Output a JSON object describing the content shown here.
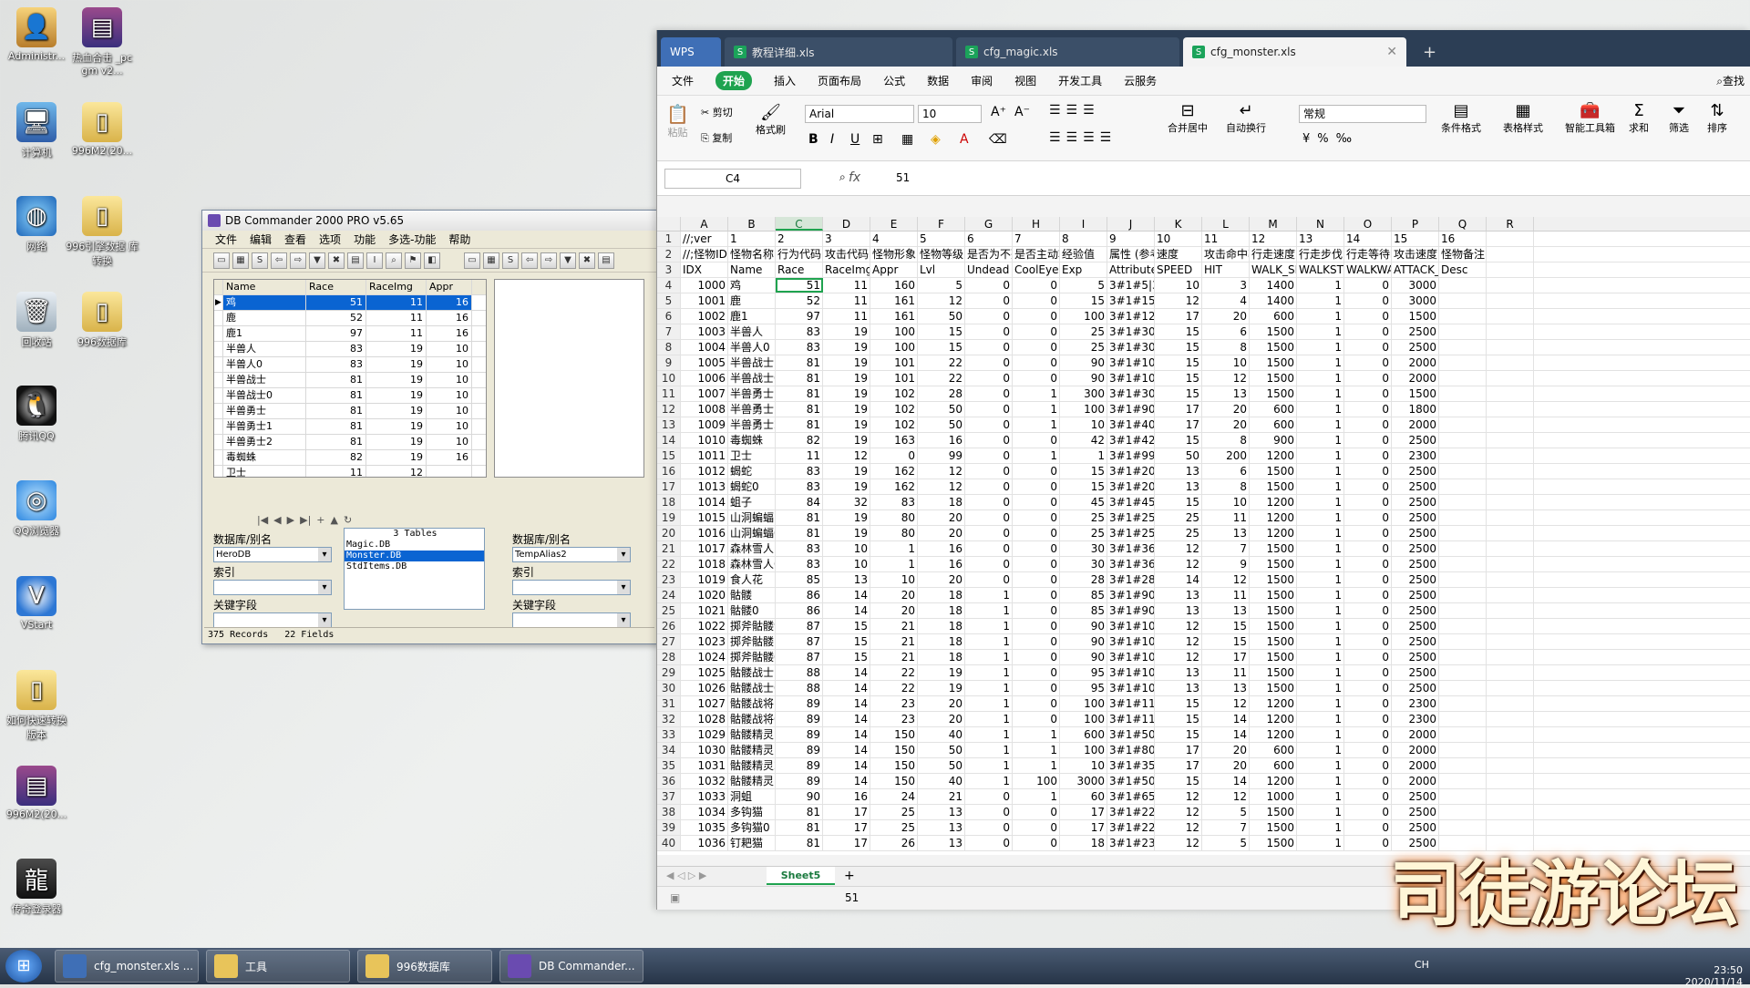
{
  "desktop": {
    "icons": [
      {
        "label": "Administr...",
        "icon": "user-folder-icon"
      },
      {
        "label": "热血合击\n_pc gm v2...",
        "icon": "rar-archive-icon"
      },
      {
        "label": "计算机",
        "icon": "computer-icon"
      },
      {
        "label": "996M2(20...",
        "icon": "folder-icon"
      },
      {
        "label": "网络",
        "icon": "network-icon"
      },
      {
        "label": "996引擎数据\n库转换",
        "icon": "folder-icon"
      },
      {
        "label": "回收站",
        "icon": "recycle-bin-icon"
      },
      {
        "label": "996数据库",
        "icon": "folder-icon"
      },
      {
        "label": "腾讯QQ",
        "icon": "qq-icon"
      },
      {
        "label": "QQ浏览器",
        "icon": "browser-icon"
      },
      {
        "label": "VStart",
        "icon": "vstart-icon"
      },
      {
        "label": "如何快速转换\n版本",
        "icon": "folder-icon"
      },
      {
        "label": "996M2(20...",
        "icon": "rar-archive-icon"
      },
      {
        "label": "传奇登录器",
        "icon": "game-launcher-icon"
      }
    ]
  },
  "dbc": {
    "title": "DB Commander 2000 PRO v5.65",
    "menu": [
      "文件",
      "编辑",
      "查看",
      "选项",
      "功能",
      "多选-功能",
      "帮助"
    ],
    "columns": [
      "Name",
      "Race",
      "RaceImg",
      "Appr"
    ],
    "rows": [
      [
        "鸡",
        "51",
        "11",
        "16"
      ],
      [
        "鹿",
        "52",
        "11",
        "16"
      ],
      [
        "鹿1",
        "97",
        "11",
        "16"
      ],
      [
        "半兽人",
        "83",
        "19",
        "10"
      ],
      [
        "半兽人0",
        "83",
        "19",
        "10"
      ],
      [
        "半兽战士",
        "81",
        "19",
        "10"
      ],
      [
        "半兽战士0",
        "81",
        "19",
        "10"
      ],
      [
        "半兽勇士",
        "81",
        "19",
        "10"
      ],
      [
        "半兽勇士1",
        "81",
        "19",
        "10"
      ],
      [
        "半兽勇士2",
        "81",
        "19",
        "10"
      ],
      [
        "毒蜘蛛",
        "82",
        "19",
        "16"
      ],
      [
        "卫士",
        "11",
        "12",
        ""
      ]
    ],
    "left_panel": {
      "db_label": "数据库/别名",
      "db_value": "HeroDB",
      "index_label": "索引",
      "key_label": "关键字段"
    },
    "tables_header": "3 Tables",
    "tables": [
      "Magic.DB",
      "Monster.DB",
      "StdItems.DB"
    ],
    "right_panel": {
      "db_label": "数据库/别名",
      "db_value": "TempAlias2",
      "index_label": "索引",
      "key_label": "关键字段"
    },
    "status": [
      "375 Records",
      "22 Fields"
    ]
  },
  "wps": {
    "tabs": [
      {
        "label": "WPS"
      },
      {
        "label": "教程详细.xls"
      },
      {
        "label": "cfg_magic.xls"
      },
      {
        "label": "cfg_monster.xls"
      }
    ],
    "menu": [
      "文件",
      "开始",
      "插入",
      "页面布局",
      "公式",
      "数据",
      "审阅",
      "视图",
      "开发工具",
      "云服务"
    ],
    "search_label": "查找",
    "ribbon": {
      "paste": "粘贴",
      "cut": "剪切",
      "copy": "复制",
      "format_painter": "格式刷",
      "font": "Arial",
      "font_size": "10",
      "number_format": "常规",
      "merge": "合并居中",
      "wrap": "自动换行",
      "cond_format": "条件格式",
      "table_style": "表格样式",
      "smart_tools": "智能工具箱",
      "sum": "求和",
      "filter": "筛选",
      "sort": "排序"
    },
    "cell_ref": "C4",
    "formula_value": "51",
    "columns": [
      "A",
      "B",
      "C",
      "D",
      "E",
      "F",
      "G",
      "H",
      "I",
      "J",
      "K",
      "L",
      "M",
      "N",
      "O",
      "P",
      "Q",
      "R"
    ],
    "header_rows": [
      [
        "//;ver",
        "1",
        "2",
        "3",
        "4",
        "5",
        "6",
        "7",
        "8",
        "9",
        "10",
        "11",
        "12",
        "13",
        "14",
        "15",
        "16",
        ""
      ],
      [
        "//;怪物IDX",
        "怪物名称",
        "行为代码",
        "攻击代码",
        "怪物形象",
        "怪物等级",
        "是否为不死",
        "是否主动攻击",
        "经验值",
        "属性 (参考",
        "速度",
        "攻击命中率",
        "行走速度间隔",
        "行走步伐",
        "行走等待时间",
        "攻击速度间隔",
        "怪物备注",
        ""
      ],
      [
        "IDX",
        "Name",
        "Race",
        "RaceImg",
        "Appr",
        "Lvl",
        "Undead",
        "CoolEye",
        "Exp",
        "Attribute",
        "SPEED",
        "HIT",
        "WALK_SPEED",
        "WALKSTEP",
        "WALKWAIT",
        "ATTACK_SPEED",
        "Desc",
        ""
      ]
    ],
    "rows": [
      [
        "1000",
        "鸡",
        "51",
        "11",
        "160",
        "5",
        "0",
        "0",
        "5",
        "3#1#5|3#",
        "10",
        "3",
        "1400",
        "1",
        "0",
        "3000"
      ],
      [
        "1001",
        "鹿",
        "52",
        "11",
        "161",
        "12",
        "0",
        "0",
        "15",
        "3#1#15|3#",
        "12",
        "4",
        "1400",
        "1",
        "0",
        "3000"
      ],
      [
        "1002",
        "鹿1",
        "97",
        "11",
        "161",
        "50",
        "0",
        "0",
        "100",
        "3#1#1200|",
        "17",
        "20",
        "600",
        "1",
        "0",
        "1500"
      ],
      [
        "1003",
        "半兽人",
        "83",
        "19",
        "100",
        "15",
        "0",
        "0",
        "25",
        "3#1#30|3#",
        "15",
        "6",
        "1500",
        "1",
        "0",
        "2500"
      ],
      [
        "1004",
        "半兽人0",
        "83",
        "19",
        "100",
        "15",
        "0",
        "0",
        "25",
        "3#1#30|3#",
        "15",
        "8",
        "1500",
        "1",
        "0",
        "2500"
      ],
      [
        "1005",
        "半兽战士",
        "81",
        "19",
        "101",
        "22",
        "0",
        "0",
        "90",
        "3#1#100|3",
        "15",
        "10",
        "1500",
        "1",
        "0",
        "2000"
      ],
      [
        "1006",
        "半兽战士0",
        "81",
        "19",
        "101",
        "22",
        "0",
        "0",
        "90",
        "3#1#100|3",
        "15",
        "12",
        "1500",
        "1",
        "0",
        "2000"
      ],
      [
        "1007",
        "半兽勇士",
        "81",
        "19",
        "102",
        "28",
        "0",
        "1",
        "300",
        "3#1#300|3",
        "15",
        "13",
        "1500",
        "1",
        "0",
        "1500"
      ],
      [
        "1008",
        "半兽勇士1",
        "81",
        "19",
        "102",
        "50",
        "0",
        "1",
        "100",
        "3#1#900|3",
        "17",
        "20",
        "600",
        "1",
        "0",
        "1800"
      ],
      [
        "1009",
        "半兽勇士2",
        "81",
        "19",
        "102",
        "50",
        "0",
        "1",
        "10",
        "3#1#400|3",
        "17",
        "20",
        "600",
        "1",
        "0",
        "2000"
      ],
      [
        "1010",
        "毒蜘蛛",
        "82",
        "19",
        "163",
        "16",
        "0",
        "0",
        "42",
        "3#1#42|3#",
        "15",
        "8",
        "900",
        "1",
        "0",
        "2500"
      ],
      [
        "1011",
        "卫士",
        "11",
        "12",
        "0",
        "99",
        "0",
        "1",
        "1",
        "3#1#9999|",
        "50",
        "200",
        "1200",
        "1",
        "0",
        "2300"
      ],
      [
        "1012",
        "蝎蛇",
        "83",
        "19",
        "162",
        "12",
        "0",
        "0",
        "15",
        "3#1#20|3#",
        "13",
        "6",
        "1500",
        "1",
        "0",
        "2500"
      ],
      [
        "1013",
        "蝎蛇0",
        "83",
        "19",
        "162",
        "12",
        "0",
        "0",
        "15",
        "3#1#20|3#",
        "13",
        "8",
        "1500",
        "1",
        "0",
        "2500"
      ],
      [
        "1014",
        "蛆子",
        "84",
        "32",
        "83",
        "18",
        "0",
        "0",
        "45",
        "3#1#45|3#",
        "15",
        "10",
        "1200",
        "1",
        "0",
        "2500"
      ],
      [
        "1015",
        "山洞蝙蝠",
        "81",
        "19",
        "80",
        "20",
        "0",
        "0",
        "25",
        "3#1#25|3#",
        "25",
        "11",
        "1200",
        "1",
        "0",
        "2500"
      ],
      [
        "1016",
        "山洞蝙蝠0",
        "81",
        "19",
        "80",
        "20",
        "0",
        "0",
        "25",
        "3#1#25|3#",
        "25",
        "13",
        "1200",
        "1",
        "0",
        "2500"
      ],
      [
        "1017",
        "森林雪人",
        "83",
        "10",
        "1",
        "16",
        "0",
        "0",
        "30",
        "3#1#36|3#",
        "12",
        "7",
        "1500",
        "1",
        "0",
        "2500"
      ],
      [
        "1018",
        "森林雪人0",
        "83",
        "10",
        "1",
        "16",
        "0",
        "0",
        "30",
        "3#1#36|3#",
        "12",
        "9",
        "1500",
        "1",
        "0",
        "2500"
      ],
      [
        "1019",
        "食人花",
        "85",
        "13",
        "10",
        "20",
        "0",
        "0",
        "28",
        "3#1#28|3#",
        "14",
        "12",
        "1500",
        "1",
        "0",
        "2500"
      ],
      [
        "1020",
        "骷髅",
        "86",
        "14",
        "20",
        "18",
        "1",
        "0",
        "85",
        "3#1#90|3#",
        "13",
        "11",
        "1500",
        "1",
        "0",
        "2500"
      ],
      [
        "1021",
        "骷髅0",
        "86",
        "14",
        "20",
        "18",
        "1",
        "0",
        "85",
        "3#1#90|3#",
        "13",
        "13",
        "1500",
        "1",
        "0",
        "2500"
      ],
      [
        "1022",
        "掷斧骷髅9",
        "87",
        "15",
        "21",
        "18",
        "1",
        "0",
        "90",
        "3#1#100|3",
        "12",
        "15",
        "1500",
        "1",
        "0",
        "2500"
      ],
      [
        "1023",
        "掷斧骷髅",
        "87",
        "15",
        "21",
        "18",
        "1",
        "0",
        "90",
        "3#1#100|3",
        "12",
        "15",
        "1500",
        "1",
        "0",
        "2500"
      ],
      [
        "1024",
        "掷斧骷髅0",
        "87",
        "15",
        "21",
        "18",
        "1",
        "0",
        "90",
        "3#1#100|3",
        "12",
        "17",
        "1500",
        "1",
        "0",
        "2500"
      ],
      [
        "1025",
        "骷髅战士",
        "88",
        "14",
        "22",
        "19",
        "1",
        "0",
        "95",
        "3#1#105|3",
        "13",
        "11",
        "1500",
        "1",
        "0",
        "2500"
      ],
      [
        "1026",
        "骷髅战士0",
        "88",
        "14",
        "22",
        "19",
        "1",
        "0",
        "95",
        "3#1#105|3",
        "13",
        "13",
        "1500",
        "1",
        "0",
        "2500"
      ],
      [
        "1027",
        "骷髅战将",
        "89",
        "14",
        "23",
        "20",
        "1",
        "0",
        "100",
        "3#1#110|3",
        "15",
        "12",
        "1200",
        "1",
        "0",
        "2300"
      ],
      [
        "1028",
        "骷髅战将0",
        "89",
        "14",
        "23",
        "20",
        "1",
        "0",
        "100",
        "3#1#110|3",
        "15",
        "14",
        "1200",
        "1",
        "0",
        "2300"
      ],
      [
        "1029",
        "骷髅精灵",
        "89",
        "14",
        "150",
        "40",
        "1",
        "1",
        "600",
        "3#1#500|3",
        "15",
        "14",
        "1200",
        "1",
        "0",
        "2000"
      ],
      [
        "1030",
        "骷髅精灵1",
        "89",
        "14",
        "150",
        "50",
        "1",
        "1",
        "100",
        "3#1#800|3",
        "17",
        "20",
        "600",
        "1",
        "0",
        "2000"
      ],
      [
        "1031",
        "骷髅精灵2",
        "89",
        "14",
        "150",
        "50",
        "1",
        "1",
        "10",
        "3#1#350|3",
        "17",
        "20",
        "600",
        "1",
        "0",
        "2000"
      ],
      [
        "1032",
        "骷髅精灵10",
        "89",
        "14",
        "150",
        "40",
        "1",
        "100",
        "3000",
        "3#1#500|3",
        "15",
        "14",
        "1200",
        "1",
        "0",
        "2000"
      ],
      [
        "1033",
        "洞蛆",
        "90",
        "16",
        "24",
        "21",
        "0",
        "1",
        "60",
        "3#1#65|3#",
        "12",
        "12",
        "1000",
        "1",
        "0",
        "2500"
      ],
      [
        "1034",
        "多钩猫",
        "81",
        "17",
        "25",
        "13",
        "0",
        "0",
        "17",
        "3#1#22|3#",
        "12",
        "5",
        "1500",
        "1",
        "0",
        "2500"
      ],
      [
        "1035",
        "多钩猫0",
        "81",
        "17",
        "25",
        "13",
        "0",
        "0",
        "17",
        "3#1#22|3#",
        "12",
        "7",
        "1500",
        "1",
        "0",
        "2500"
      ],
      [
        "1036",
        "钉耙猫",
        "81",
        "17",
        "26",
        "13",
        "0",
        "0",
        "18",
        "3#1#23|3#",
        "12",
        "5",
        "1500",
        "1",
        "0",
        "2500"
      ]
    ],
    "sheet_tab": "Sheet5",
    "status_value": "51"
  },
  "taskbar": {
    "items": [
      {
        "label": "cfg_monster.xls ..."
      },
      {
        "label": "工具"
      },
      {
        "label": "996数据库"
      },
      {
        "label": "DB Commander..."
      }
    ],
    "lang": "CH",
    "time": "23:50",
    "date": "2020/11/14"
  },
  "watermark": "司徒游论坛"
}
